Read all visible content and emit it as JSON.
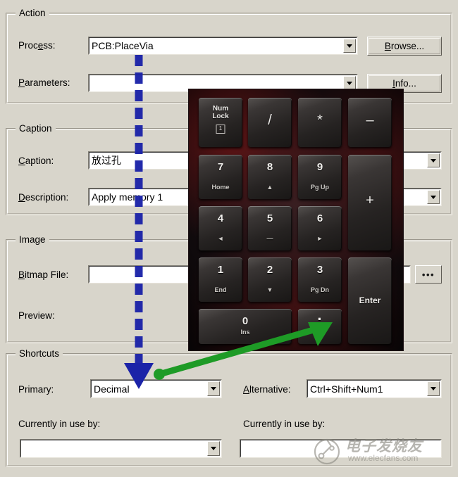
{
  "dialog": {
    "background_color": "#d8d5cb"
  },
  "groups": {
    "action": {
      "title": "Action"
    },
    "caption": {
      "title": "Caption"
    },
    "image": {
      "title": "Image"
    },
    "shortcuts": {
      "title": "Shortcuts"
    }
  },
  "action": {
    "process_label": "Process:",
    "process_label_pre": "Proc",
    "process_label_mnemonic": "e",
    "process_label_post": "ss:",
    "process_value": "PCB:PlaceVia",
    "parameters_label_pre": "",
    "parameters_label_mnemonic": "P",
    "parameters_label_post": "arameters:",
    "parameters_value": "",
    "browse_pre": "",
    "browse_mnemonic": "B",
    "browse_post": "rowse...",
    "info_pre": "",
    "info_mnemonic": "I",
    "info_post": "nfo..."
  },
  "caption": {
    "caption_label_mnemonic": "C",
    "caption_label_post": "aption:",
    "caption_value": "放过孔",
    "description_label_mnemonic": "D",
    "description_label_post": "escription:",
    "description_value": "Apply memory 1"
  },
  "image": {
    "bitmap_label_mnemonic": "B",
    "bitmap_label_post": "itmap File:",
    "bitmap_value": "",
    "browse_ellipsis": "•••",
    "preview_label": "Preview:"
  },
  "shortcuts": {
    "primary_label": "Primary:",
    "primary_value": "Decimal",
    "alternative_label_mnemonic": "A",
    "alternative_label_post": "lternative:",
    "alternative_value": "Ctrl+Shift+Num1",
    "primary_in_use_label": "Currently in use by:",
    "primary_in_use_value": "",
    "alternative_in_use_label": "Currently in use by:",
    "alternative_in_use_value": ""
  },
  "numpad": {
    "keys": [
      {
        "main": "Num",
        "main2": "Lock",
        "sub": "",
        "led": "1",
        "row": 0,
        "col": 0
      },
      {
        "main": "/",
        "sub": "",
        "row": 0,
        "col": 1
      },
      {
        "main": "*",
        "sub": "",
        "row": 0,
        "col": 2
      },
      {
        "main": "–",
        "sub": "",
        "row": 0,
        "col": 3
      },
      {
        "main": "7",
        "sub": "Home",
        "row": 1,
        "col": 0
      },
      {
        "main": "8",
        "sub": "▲",
        "row": 1,
        "col": 1
      },
      {
        "main": "9",
        "sub": "Pg Up",
        "row": 1,
        "col": 2
      },
      {
        "main": "+",
        "sub": "",
        "row": 1,
        "col": 3
      },
      {
        "main": "4",
        "sub": "◄",
        "row": 2,
        "col": 0
      },
      {
        "main": "5",
        "sub": "—",
        "row": 2,
        "col": 1
      },
      {
        "main": "6",
        "sub": "►",
        "row": 2,
        "col": 2
      },
      {
        "main": "1",
        "sub": "End",
        "row": 3,
        "col": 0
      },
      {
        "main": "2",
        "sub": "▼",
        "row": 3,
        "col": 1
      },
      {
        "main": "3",
        "sub": "Pg Dn",
        "row": 3,
        "col": 2
      },
      {
        "main": "Enter",
        "sub": "",
        "row": 3,
        "col": 3
      },
      {
        "main": "0",
        "sub": "Ins",
        "row": 4,
        "col": 0
      },
      {
        "main": "·",
        "sub": "Del",
        "row": 4,
        "col": 2
      }
    ]
  },
  "annotations": {
    "blue_arrow_color": "#1b23a8",
    "green_arrow_color": "#1e9b26"
  },
  "watermark": {
    "text_cn": "电子发烧友",
    "url": "www.elecfans.com"
  }
}
